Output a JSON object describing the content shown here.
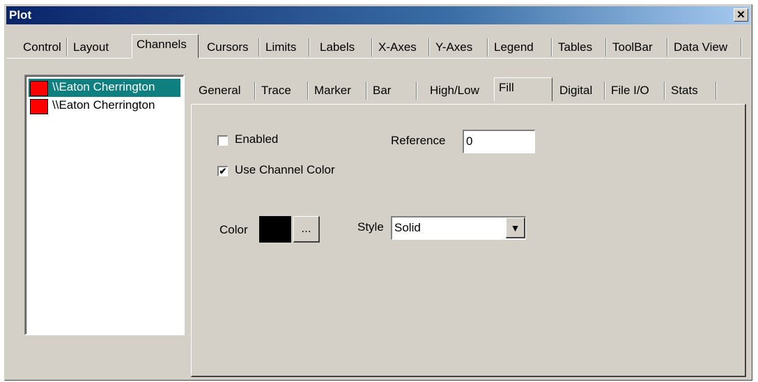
{
  "window": {
    "title": "Plot",
    "close_glyph": "✕"
  },
  "main_tabs": [
    "Control",
    "Layout",
    "Channels",
    "Cursors",
    "Limits",
    "Labels",
    "X-Axes",
    "Y-Axes",
    "Legend",
    "Tables",
    "ToolBar",
    "Data View"
  ],
  "selected_main_tab": "Channels",
  "channels": [
    {
      "label": "\\\\Eaton Cherrington",
      "color": "#ff0000",
      "selected": true
    },
    {
      "label": "\\\\Eaton Cherrington",
      "color": "#ff0000",
      "selected": false
    }
  ],
  "sub_tabs": [
    "General",
    "Trace",
    "Marker",
    "Bar",
    "High/Low",
    "Fill",
    "Digital",
    "File I/O",
    "Stats"
  ],
  "selected_sub_tab": "Fill",
  "fill": {
    "enabled_label": "Enabled",
    "enabled_checked": false,
    "use_channel_color_label": "Use Channel Color",
    "use_channel_color_checked": true,
    "reference_label": "Reference",
    "reference_value": "0",
    "color_label": "Color",
    "color_value": "#000000",
    "color_button_label": "...",
    "style_label": "Style",
    "style_value": "Solid",
    "check_glyph": "✔",
    "dropdown_glyph": "▼"
  }
}
